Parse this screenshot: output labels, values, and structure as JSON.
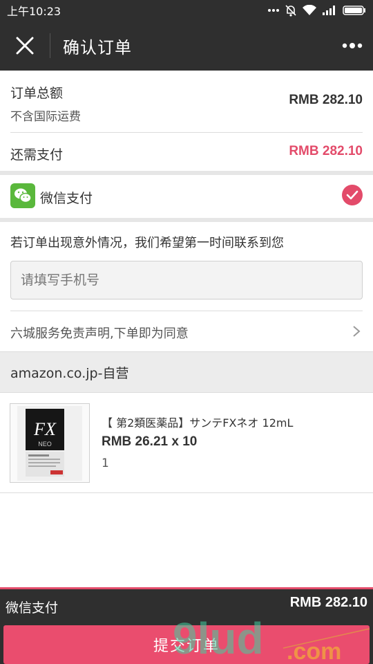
{
  "status_bar": {
    "time": "上午10:23"
  },
  "header": {
    "title": "确认订单"
  },
  "order": {
    "total_label": "订单总额",
    "total_note": "不含国际运费",
    "total_value": "RMB 282.10",
    "due_label": "还需支付",
    "due_value": "RMB 282.10"
  },
  "payment": {
    "method_label": "微信支付"
  },
  "contact": {
    "prompt": "若订单出现意外情况，我们希望第一时间联系到您",
    "phone_placeholder": "请填写手机号"
  },
  "disclaimer": {
    "text": "六城服务免责声明,下单即为同意"
  },
  "store": {
    "name": "amazon.co.jp-自营"
  },
  "product": {
    "name": "【 第2類医薬品】サンテFXネオ 12mL",
    "price": "RMB 26.21 x 10",
    "quantity": "1"
  },
  "footer": {
    "pay_label": "微信支付",
    "total": "RMB 282.10",
    "submit_label": "提交订单"
  },
  "colors": {
    "accent": "#e34b6a",
    "wechat_green": "#5ab83c",
    "bar_bg": "#2f2f2f"
  }
}
